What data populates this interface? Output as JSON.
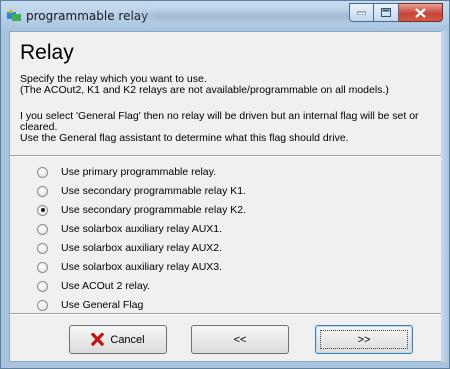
{
  "window": {
    "title": "programmable relay",
    "icon": "relay-app-icon",
    "controls": {
      "minimize": "minimize-icon",
      "maximize": "maximize-icon",
      "close": "close-icon"
    }
  },
  "page": {
    "heading": "Relay",
    "desc_line1": "Specify the relay which you want to use.",
    "desc_line2": "(The ACOut2, K1 and K2 relays are not available/programmable on all models.)",
    "desc_line3": "I  you select 'General Flag' then no relay will be driven but an internal flag will be set or",
    "desc_line4": "cleared.",
    "desc_line5": "Use the General flag assistant to determine what this flag should drive."
  },
  "options": [
    {
      "label": "Use primary programmable relay.",
      "selected": false
    },
    {
      "label": "Use secondary programmable relay K1.",
      "selected": false
    },
    {
      "label": "Use secondary programmable relay K2.",
      "selected": true
    },
    {
      "label": "Use solarbox auxiliary relay AUX1.",
      "selected": false
    },
    {
      "label": "Use solarbox auxiliary relay AUX2.",
      "selected": false
    },
    {
      "label": "Use solarbox auxiliary relay AUX3.",
      "selected": false
    },
    {
      "label": "Use ACOut 2 relay.",
      "selected": false
    },
    {
      "label": "Use General Flag",
      "selected": false
    }
  ],
  "buttons": {
    "cancel": "Cancel",
    "back": "<<",
    "next": ">>"
  },
  "colors": {
    "cancel_icon": "#c0140c",
    "frame": "#a9c4de"
  }
}
